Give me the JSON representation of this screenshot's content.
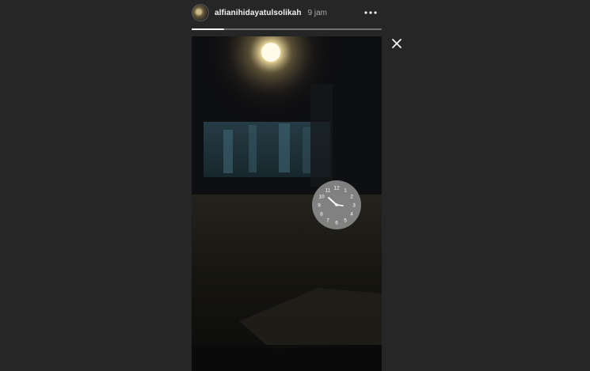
{
  "story": {
    "username": "alfianihidayatulsolikah",
    "timestamp": "9 jam",
    "progress_fraction": 0.17
  },
  "icons": {
    "more": "more-horizontal-icon",
    "close": "close-icon"
  },
  "clock_sticker": {
    "numerals": [
      "12",
      "1",
      "2",
      "3",
      "4",
      "5",
      "6",
      "7",
      "8",
      "9",
      "10",
      "11"
    ]
  },
  "colors": {
    "background": "#262626",
    "text_primary": "#f2f2f2",
    "text_secondary": "#a8a8a8",
    "clock_face": "#8a8a8a"
  }
}
